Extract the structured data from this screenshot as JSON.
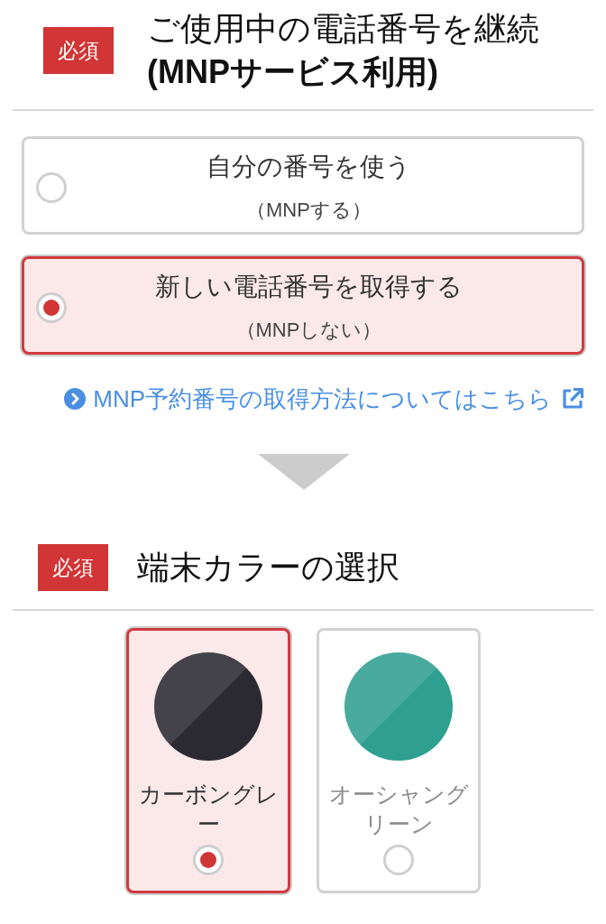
{
  "number_section": {
    "badge": "必須",
    "title": "ご使用中の電話番号を継続",
    "title_note": "(MNPサービス利用)",
    "options": [
      {
        "label": "自分の番号を使う",
        "note": "（MNPする）",
        "selected": false
      },
      {
        "label": "新しい電話番号を取得する",
        "note": "（MNPしない）",
        "selected": true
      }
    ],
    "link": {
      "text": "MNP予約番号の取得方法についてはこちら"
    }
  },
  "color_section": {
    "badge": "必須",
    "title": "端末カラーの選択",
    "colors": [
      {
        "label": "カーボングレー",
        "color": "#2b2a30",
        "selected": true
      },
      {
        "label": "オーシャングリーン",
        "color": "#2fa090",
        "selected": false
      }
    ]
  }
}
